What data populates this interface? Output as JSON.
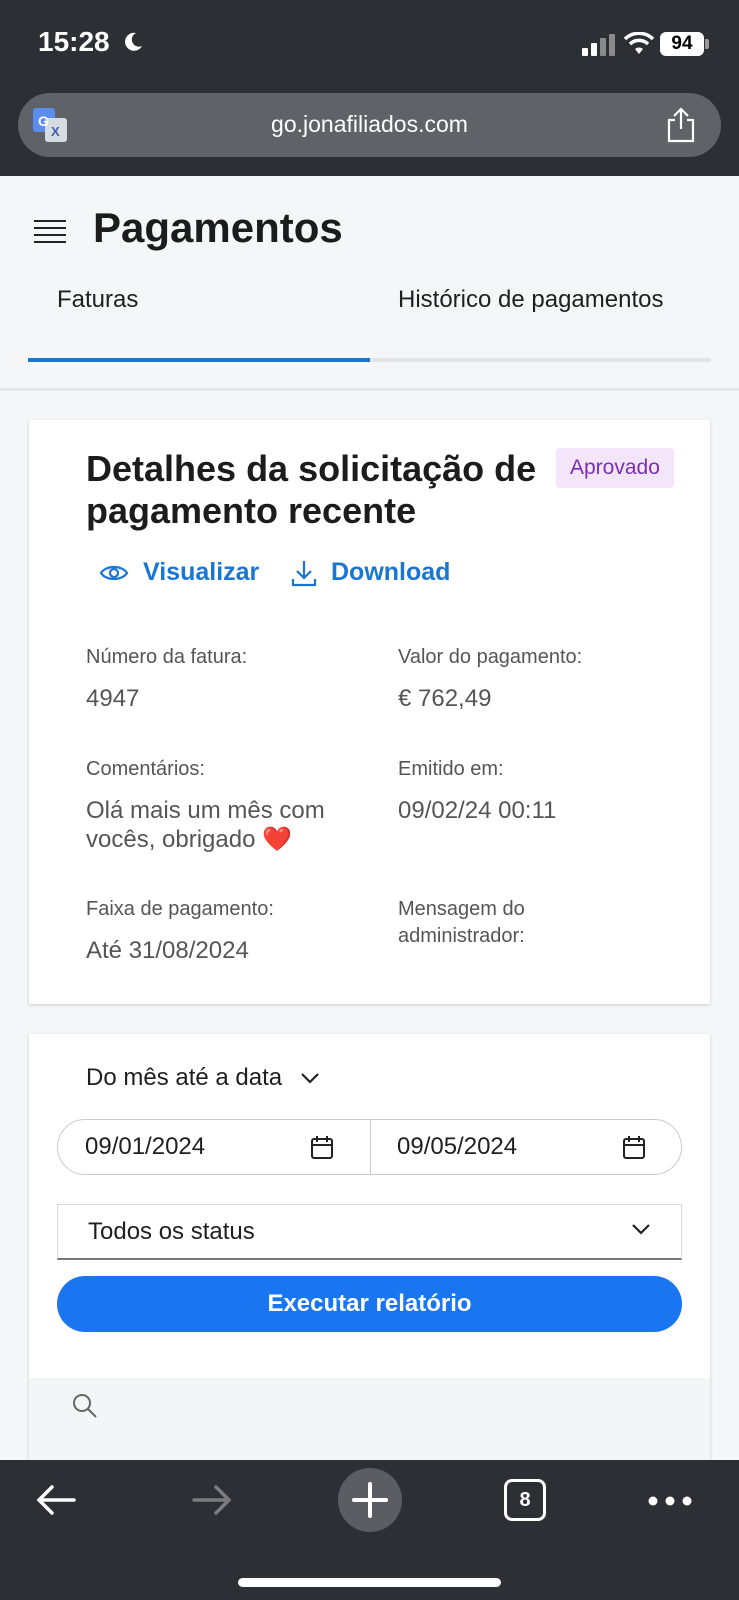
{
  "status_bar": {
    "time": "15:28",
    "battery": "94"
  },
  "browser": {
    "url": "go.jonafiliados.com",
    "tab_count": "8"
  },
  "page": {
    "title": "Pagamentos",
    "tabs": [
      {
        "label": "Faturas",
        "active": true
      },
      {
        "label": "Histórico de pagamentos",
        "active": false
      }
    ]
  },
  "details": {
    "title": "Detalhes da solicitação de pagamento recente",
    "status_badge": "Aprovado",
    "view_label": "Visualizar",
    "download_label": "Download",
    "invoice_number_label": "Número da fatura:",
    "invoice_number": "4947",
    "payment_value_label": "Valor do pagamento:",
    "payment_value": "€ 762,49",
    "comments_label": "Comentários:",
    "comments": "Olá mais um mês com vocês, obrigado ❤️",
    "issued_label": "Emitido em:",
    "issued": "09/02/24 00:11",
    "range_label": "Faixa de pagamento:",
    "range": "Até 31/08/2024",
    "admin_message_label": "Mensagem do administrador:"
  },
  "report": {
    "period": "Do mês até a data",
    "start_date": "09/01/2024",
    "end_date": "09/05/2024",
    "status_filter": "Todos os status",
    "run_label": "Executar relatório"
  },
  "colors": {
    "accent": "#1976d2",
    "button": "#1976f0",
    "badge_bg": "#f3e6fb",
    "badge_text": "#7a2fb5",
    "chrome": "#2c2f33"
  }
}
